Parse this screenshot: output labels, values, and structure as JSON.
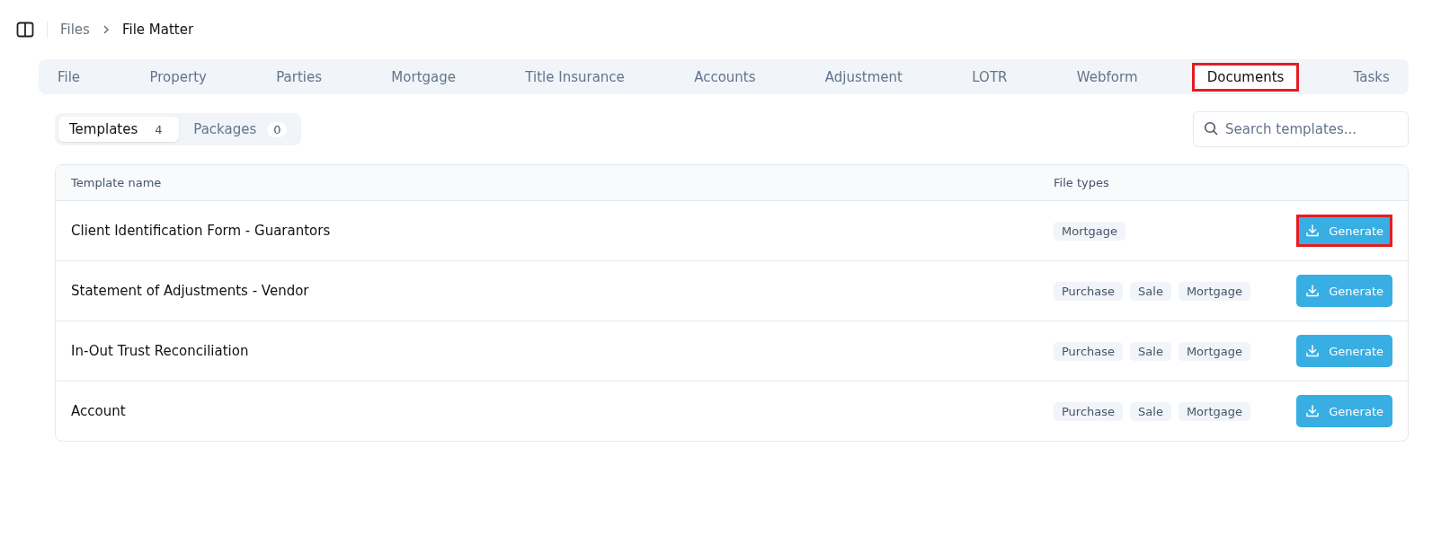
{
  "breadcrumb": [
    {
      "label": "Files",
      "current": false
    },
    {
      "label": "File Matter",
      "current": true
    }
  ],
  "tabs": [
    {
      "label": "File",
      "selected": false,
      "highlighted": false
    },
    {
      "label": "Property",
      "selected": false,
      "highlighted": false
    },
    {
      "label": "Parties",
      "selected": false,
      "highlighted": false
    },
    {
      "label": "Mortgage",
      "selected": false,
      "highlighted": false
    },
    {
      "label": "Title Insurance",
      "selected": false,
      "highlighted": false
    },
    {
      "label": "Accounts",
      "selected": false,
      "highlighted": false
    },
    {
      "label": "Adjustment",
      "selected": false,
      "highlighted": false
    },
    {
      "label": "LOTR",
      "selected": false,
      "highlighted": false
    },
    {
      "label": "Webform",
      "selected": false,
      "highlighted": false
    },
    {
      "label": "Documents",
      "selected": true,
      "highlighted": true
    },
    {
      "label": "Tasks",
      "selected": false,
      "highlighted": false
    }
  ],
  "subtabs": [
    {
      "label": "Templates",
      "count": "4",
      "selected": true
    },
    {
      "label": "Packages",
      "count": "0",
      "selected": false
    }
  ],
  "search": {
    "placeholder": "Search templates..."
  },
  "table": {
    "columns": [
      "Template name",
      "File types"
    ],
    "rows": [
      {
        "name": "Client Identification Form - Guarantors",
        "file_types": [
          "Mortgage"
        ],
        "action": "Generate",
        "highlighted": true
      },
      {
        "name": "Statement of Adjustments - Vendor",
        "file_types": [
          "Purchase",
          "Sale",
          "Mortgage"
        ],
        "action": "Generate",
        "highlighted": false
      },
      {
        "name": "In-Out Trust Reconciliation",
        "file_types": [
          "Purchase",
          "Sale",
          "Mortgage"
        ],
        "action": "Generate",
        "highlighted": false
      },
      {
        "name": "Account",
        "file_types": [
          "Purchase",
          "Sale",
          "Mortgage"
        ],
        "action": "Generate",
        "highlighted": false
      }
    ]
  }
}
